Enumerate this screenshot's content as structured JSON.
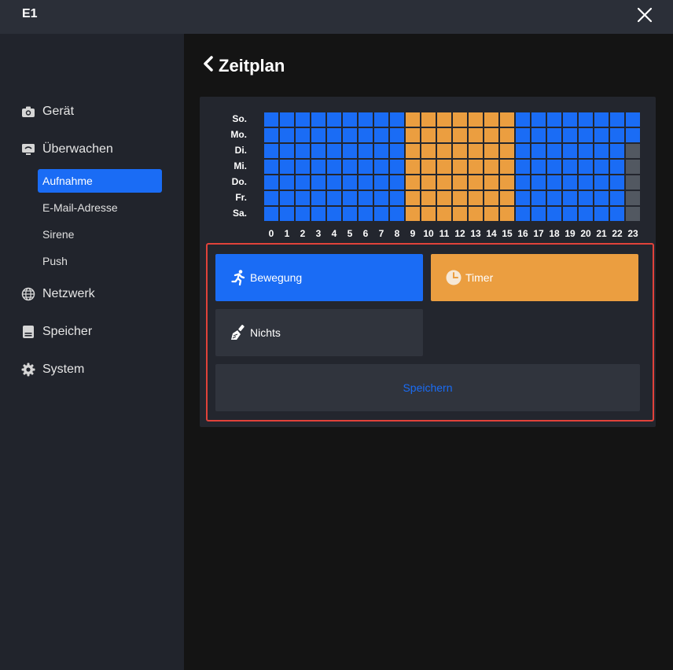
{
  "window": {
    "title": "E1"
  },
  "colors": {
    "accent": "#1a6cf5",
    "timer": "#eb9e40",
    "none": "#525861",
    "highlight_border": "#e1423a"
  },
  "sidebar": {
    "items": [
      {
        "label": "Gerät",
        "icon": "camera-icon"
      },
      {
        "label": "Überwachen",
        "icon": "monitor-icon"
      },
      {
        "label": "Netzwerk",
        "icon": "globe-icon"
      },
      {
        "label": "Speicher",
        "icon": "storage-icon"
      },
      {
        "label": "System",
        "icon": "gear-icon"
      }
    ],
    "subitems": [
      {
        "label": "Aufnahme",
        "active": true
      },
      {
        "label": "E-Mail-Adresse",
        "active": false
      },
      {
        "label": "Sirene",
        "active": false
      },
      {
        "label": "Push",
        "active": false
      }
    ]
  },
  "page": {
    "title": "Zeitplan"
  },
  "schedule": {
    "days": [
      "So.",
      "Mo.",
      "Di.",
      "Mi.",
      "Do.",
      "Fr.",
      "Sa."
    ],
    "hours": [
      "0",
      "1",
      "2",
      "3",
      "4",
      "5",
      "6",
      "7",
      "8",
      "9",
      "10",
      "11",
      "12",
      "13",
      "14",
      "15",
      "16",
      "17",
      "18",
      "19",
      "20",
      "21",
      "22",
      "23"
    ],
    "rows": [
      "MMMMMMMMMTTTTTTTMMMMMMMM",
      "MMMMMMMMMTTTTTTTMMMMMMMM",
      "MMMMMMMMMTTTTTTTMMMMMMMN",
      "MMMMMMMMMTTTTTTTMMMMMMMN",
      "MMMMMMMMMTTTTTTTMMMMMMMN",
      "MMMMMMMMMTTTTTTTMMMMMMMN",
      "MMMMMMMMMTTTTTTTMMMMMMMN"
    ]
  },
  "modes": {
    "motion": {
      "label": "Bewegung",
      "icon": "running-person-icon"
    },
    "timer": {
      "label": "Timer",
      "icon": "clock-icon"
    },
    "none": {
      "label": "Nichts",
      "icon": "eraser-brush-icon"
    }
  },
  "actions": {
    "save_label": "Speichern"
  }
}
